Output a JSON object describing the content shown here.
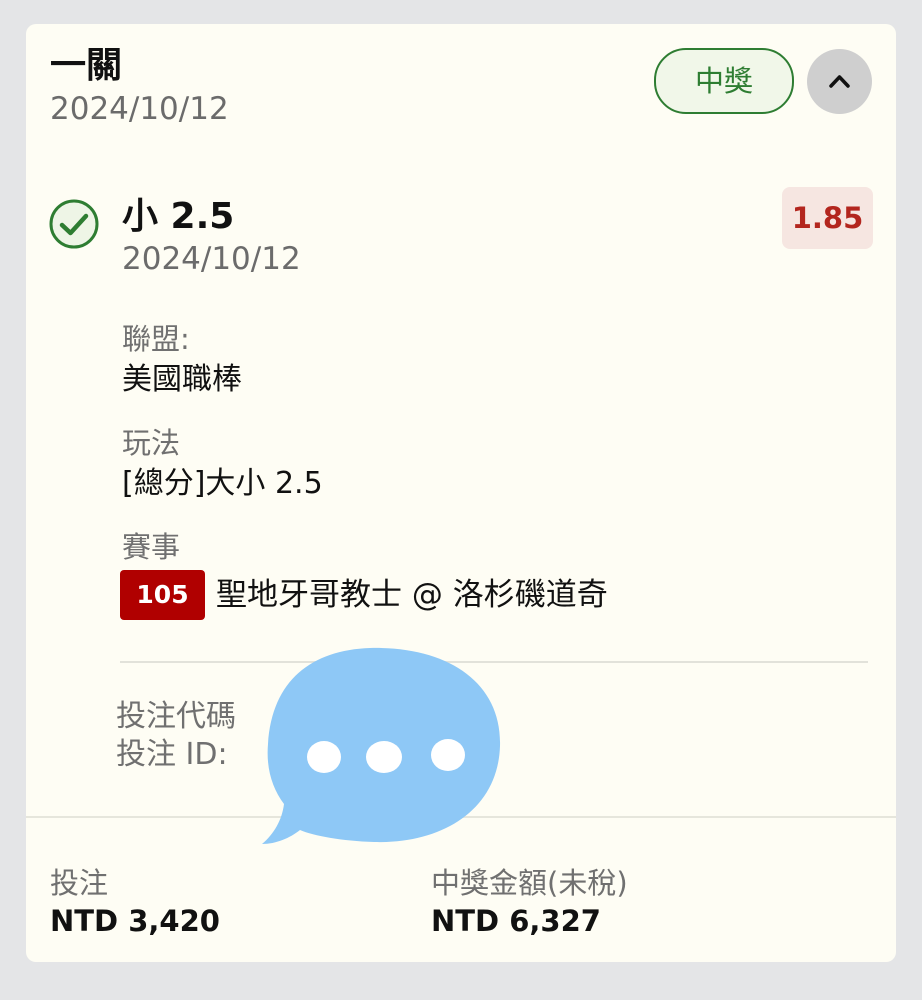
{
  "ticket": {
    "type": "一關",
    "date": "2024/10/12",
    "status_badge": "中獎",
    "collapse_icon": "chevron-up-icon"
  },
  "selection": {
    "status_icon": "check-circle-icon",
    "name": "小 2.5",
    "date": "2024/10/12",
    "odds": "1.85",
    "league_label": "聯盟:",
    "league_value": "美國職棒",
    "market_label": "玩法",
    "market_value": "[總分]大小 2.5",
    "event_label": "賽事",
    "event_id": "105",
    "event_name": "聖地牙哥教士 @ 洛杉磯道奇"
  },
  "bet_info": {
    "code_label": "投注代碼",
    "id_label": "投注 ID:"
  },
  "footer": {
    "stake_label": "投注",
    "stake_value": "NTD 3,420",
    "payout_label": "中獎金額(未稅)",
    "payout_value": "NTD 6,327"
  },
  "overlay": {
    "icon": "chat-bubble-icon"
  },
  "colors": {
    "win_green": "#2e7d32",
    "odds_red": "#b3261e",
    "event_badge": "#b00000",
    "sticker_blue": "#8ec8f6"
  }
}
